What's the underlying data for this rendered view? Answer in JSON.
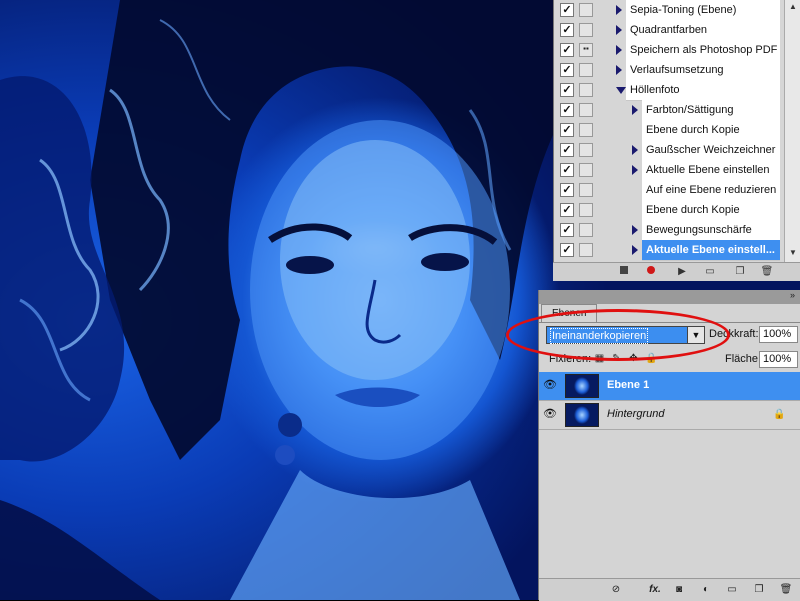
{
  "actions_panel": {
    "items": [
      {
        "label": "Sepia-Toning (Ebene)",
        "checked": true,
        "dialog": false,
        "expander": "collapsed",
        "indent": 0,
        "selected": false
      },
      {
        "label": "Quadrantfarben",
        "checked": true,
        "dialog": false,
        "expander": "collapsed",
        "indent": 0,
        "selected": false
      },
      {
        "label": "Speichern als Photoshop PDF",
        "checked": true,
        "dialog": true,
        "expander": "collapsed",
        "indent": 0,
        "selected": false
      },
      {
        "label": "Verlaufsumsetzung",
        "checked": true,
        "dialog": false,
        "expander": "collapsed",
        "indent": 0,
        "selected": false
      },
      {
        "label": "Höllenfoto",
        "checked": true,
        "dialog": false,
        "expander": "expanded",
        "indent": 0,
        "selected": false
      },
      {
        "label": "Farbton/Sättigung",
        "checked": true,
        "dialog": false,
        "expander": "collapsed",
        "indent": 1,
        "selected": false
      },
      {
        "label": "Ebene durch Kopie",
        "checked": true,
        "dialog": false,
        "expander": "none",
        "indent": 1,
        "selected": false
      },
      {
        "label": "Gaußscher Weichzeichner",
        "checked": true,
        "dialog": false,
        "expander": "collapsed",
        "indent": 1,
        "selected": false
      },
      {
        "label": "Aktuelle Ebene einstellen",
        "checked": true,
        "dialog": false,
        "expander": "collapsed",
        "indent": 1,
        "selected": false
      },
      {
        "label": "Auf eine Ebene reduzieren",
        "checked": true,
        "dialog": false,
        "expander": "none",
        "indent": 1,
        "selected": false
      },
      {
        "label": "Ebene durch Kopie",
        "checked": true,
        "dialog": false,
        "expander": "none",
        "indent": 1,
        "selected": false
      },
      {
        "label": "Bewegungsunschärfe",
        "checked": true,
        "dialog": false,
        "expander": "collapsed",
        "indent": 1,
        "selected": false
      },
      {
        "label": "Aktuelle Ebene einstell...",
        "checked": true,
        "dialog": false,
        "expander": "collapsed",
        "indent": 1,
        "selected": true
      }
    ],
    "toolbar_icons": [
      "stop-icon",
      "record-icon",
      "play-icon",
      "new-set-icon",
      "new-action-icon",
      "delete-icon"
    ]
  },
  "layers_panel": {
    "tab_label": "Ebenen",
    "blend_mode": "Ineinanderkopieren",
    "opacity_label": "Deckkraft:",
    "opacity_value": "100%",
    "lock_label": "Fixieren:",
    "fill_label": "Fläche:",
    "fill_value": "100%",
    "layers": [
      {
        "name": "Ebene 1",
        "visible": true,
        "selected": true,
        "locked": false
      },
      {
        "name": "Hintergrund",
        "visible": true,
        "selected": false,
        "locked": true
      }
    ],
    "bottom_icons": [
      "link-icon",
      "fx-icon",
      "mask-icon",
      "adjustment-icon",
      "group-icon",
      "new-layer-icon",
      "trash-icon"
    ],
    "fx_label": "fx."
  },
  "colors": {
    "selection": "#3e8ff0",
    "annotation_ellipse": "#e01010",
    "panel_bg": "#d4d4d4"
  },
  "canvas": {
    "subject": "blue-toned portrait photograph"
  }
}
